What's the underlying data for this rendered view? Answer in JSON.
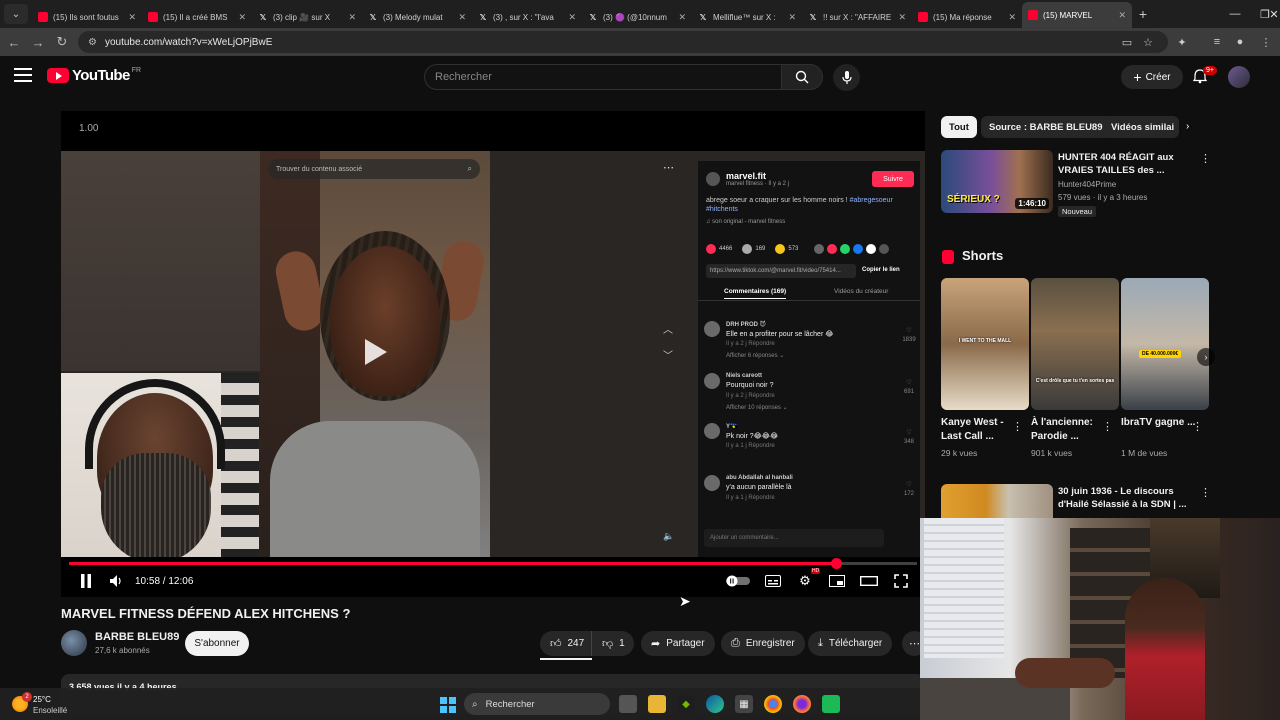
{
  "browser": {
    "tabs": [
      {
        "icon": "youtube-icon",
        "title": "(15) Ils sont foutus"
      },
      {
        "icon": "youtube-icon",
        "title": "(15) Il a créé BMS"
      },
      {
        "icon": "x-icon",
        "title": "(3) clip 🎥 sur X"
      },
      {
        "icon": "x-icon",
        "title": "(3) Melody mulat"
      },
      {
        "icon": "x-icon",
        "title": "(3) , sur X : \"l'ava"
      },
      {
        "icon": "x-icon",
        "title": "(3) 🟣 (@10nnum"
      },
      {
        "icon": "x-icon",
        "title": "Melliflue™ sur X :"
      },
      {
        "icon": "x-icon",
        "title": "!! sur X : \"AFFAIRE"
      },
      {
        "icon": "youtube-icon",
        "title": "(15) Ma réponse"
      },
      {
        "icon": "youtube-icon",
        "title": "(15) MARVEL"
      }
    ],
    "url": "youtube.com/watch?v=xWeLjOPjBwE"
  },
  "youtube": {
    "logo_text": "YouTube",
    "country": "FR",
    "search_placeholder": "Rechercher",
    "create_label": "Créer",
    "notif_count": "9+"
  },
  "player": {
    "speed_text": "1.00",
    "time": "10:58 / 12:06",
    "progress": 0.905,
    "tiktok": {
      "search_placeholder": "Trouver du contenu associé",
      "username": "marvel.fit",
      "subline": "marvel fitness · Il y a 2 j",
      "follow_label": "Suivre",
      "desc": "abrege soeur a craquer sur les homme noirs !",
      "tags": "#abregesoeur #hitchents",
      "sound": "♫ son original - marvel fitness",
      "stat_likes": "4466",
      "stat_comments": "169",
      "stat_saves": "573",
      "link": "https://www.tiktok.com/@marvel.fit/video/75414...",
      "copy_label": "Copier le lien",
      "tab_comments": "Commentaires (169)",
      "tab_videos": "Vidéos du créateur",
      "comments": [
        {
          "author": "DRH PROD 😈",
          "text": "Elle en a profiter pour se lâcher 😂",
          "meta": "Il y a 2 j     Répondre",
          "more": "Afficher 6 réponses ⌄",
          "likes": "1839"
        },
        {
          "author": "Niels careott",
          "text": "Pourquoi noir ?",
          "meta": "Il y a 2 j     Répondre",
          "more": "Afficher 10 réponses ⌄",
          "likes": "691"
        },
        {
          "author": "Y🇬🇵",
          "text": "Pk noir ?😂😂😂",
          "meta": "Il y a 1 j     Répondre",
          "more": "",
          "likes": "348"
        },
        {
          "author": "abu Abdallah al hanbali",
          "text": "y'a aucun parallèle là",
          "meta": "Il y a 1 j     Répondre",
          "more": "",
          "likes": "172"
        }
      ],
      "compose_placeholder": "Ajouter un commentaire..."
    }
  },
  "video": {
    "title": "MARVEL FITNESS DÉFEND ALEX HITCHENS ?",
    "channel": "BARBE BLEU89",
    "subscribers": "27,6 k abonnés",
    "subscribe_label": "S'abonner",
    "likes": "247",
    "dislikes": "1",
    "share_label": "Partager",
    "save_label": "Enregistrer",
    "download_label": "Télécharger",
    "desc_preview": "3 658 vues  il y a 4 heures"
  },
  "sidebar": {
    "chips": [
      "Tout",
      "Source : BARBE BLEU89",
      "Vidéos similai"
    ],
    "rec1": {
      "title": "HUNTER 404 RÉAGIT aux VRAIES TAILLES des ...",
      "channel": "Hunter404Prime",
      "meta": "579 vues · il y a 3 heures",
      "badge": "Nouveau",
      "duration": "1:46:10",
      "thumb_text": "SÉRIEUX ?"
    },
    "shorts_title": "Shorts",
    "shorts": [
      {
        "title": "Kanye West - Last Call ...",
        "views": "29 k vues",
        "caption": "I WENT TO THE MALL"
      },
      {
        "title": "À l'ancienne: Parodie ...",
        "views": "901 k vues",
        "caption": "C'est drôle que tu t'en sortes pas"
      },
      {
        "title": "IbraTV gagne ...",
        "views": "1 M de vues",
        "caption": "DE 40.000.000€"
      }
    ],
    "rec2": {
      "title": "30 juin 1936 - Le discours d'Hailé Sélassié à la SDN | ..."
    }
  },
  "taskbar": {
    "temp": "25°C",
    "weather": "Ensoleillé",
    "weather_badge": "2",
    "search_label": "Rechercher"
  }
}
